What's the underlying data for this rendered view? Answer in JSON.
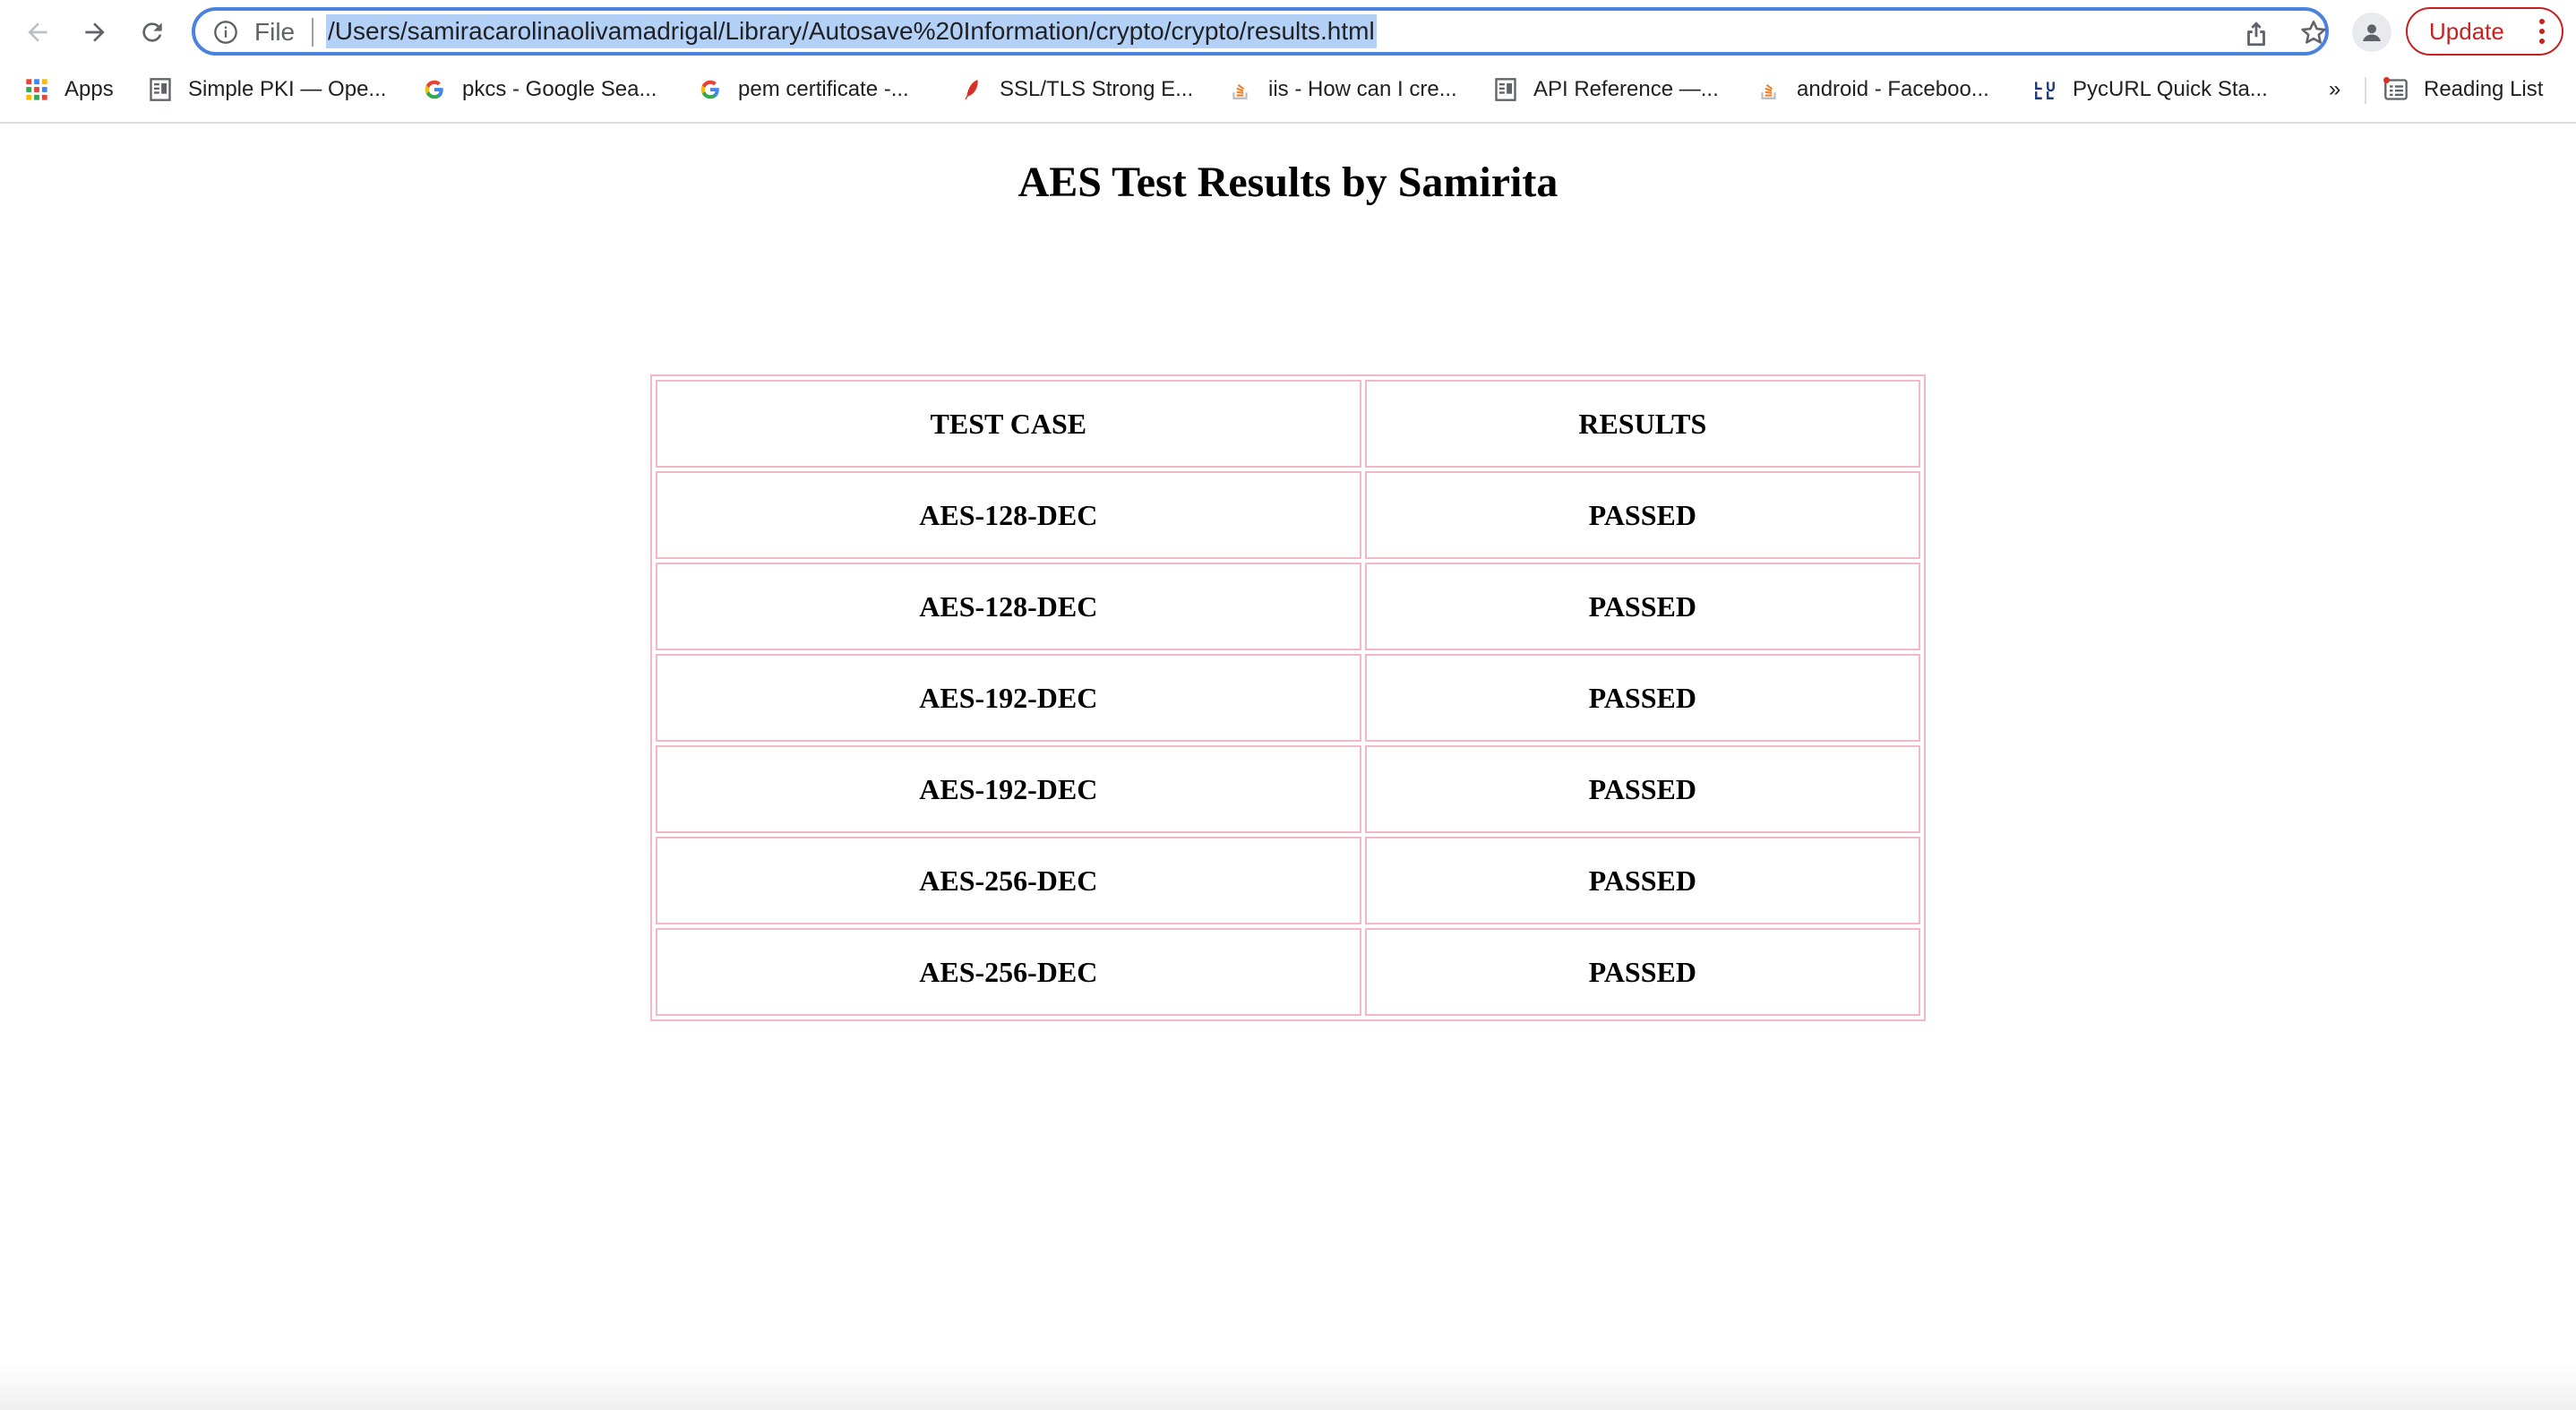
{
  "browser": {
    "scheme_label": "File",
    "url": "/Users/samiracarolinaolivamadrigal/Library/Autosave%20Information/crypto/crypto/results.html",
    "update_label": "Update",
    "accent_color": "#4b82e0",
    "update_color": "#c5221f"
  },
  "bookmarks": [
    {
      "label": "Apps",
      "icon": "apps-grid-icon"
    },
    {
      "label": "Simple PKI — Ope...",
      "icon": "document-icon"
    },
    {
      "label": "pkcs - Google Sea...",
      "icon": "google-icon"
    },
    {
      "label": "pem certificate -...",
      "icon": "google-icon"
    },
    {
      "label": "SSL/TLS Strong E...",
      "icon": "feather-icon"
    },
    {
      "label": "iis - How can I cre...",
      "icon": "stackoverflow-icon"
    },
    {
      "label": "API Reference —...",
      "icon": "document-icon"
    },
    {
      "label": "android - Faceboo...",
      "icon": "stackoverflow-icon"
    },
    {
      "label": "PycURL Quick Sta...",
      "icon": "curl-icon"
    }
  ],
  "bookmarks_overflow": "»",
  "reading_list_label": "Reading List",
  "page": {
    "title": "AES Test Results by Samirita",
    "table": {
      "headers": [
        "TEST CASE",
        "RESULTS"
      ],
      "rows": [
        [
          "AES-128-DEC",
          "PASSED"
        ],
        [
          "AES-128-DEC",
          "PASSED"
        ],
        [
          "AES-192-DEC",
          "PASSED"
        ],
        [
          "AES-192-DEC",
          "PASSED"
        ],
        [
          "AES-256-DEC",
          "PASSED"
        ],
        [
          "AES-256-DEC",
          "PASSED"
        ]
      ],
      "border_color": "#f2b8c6"
    }
  }
}
